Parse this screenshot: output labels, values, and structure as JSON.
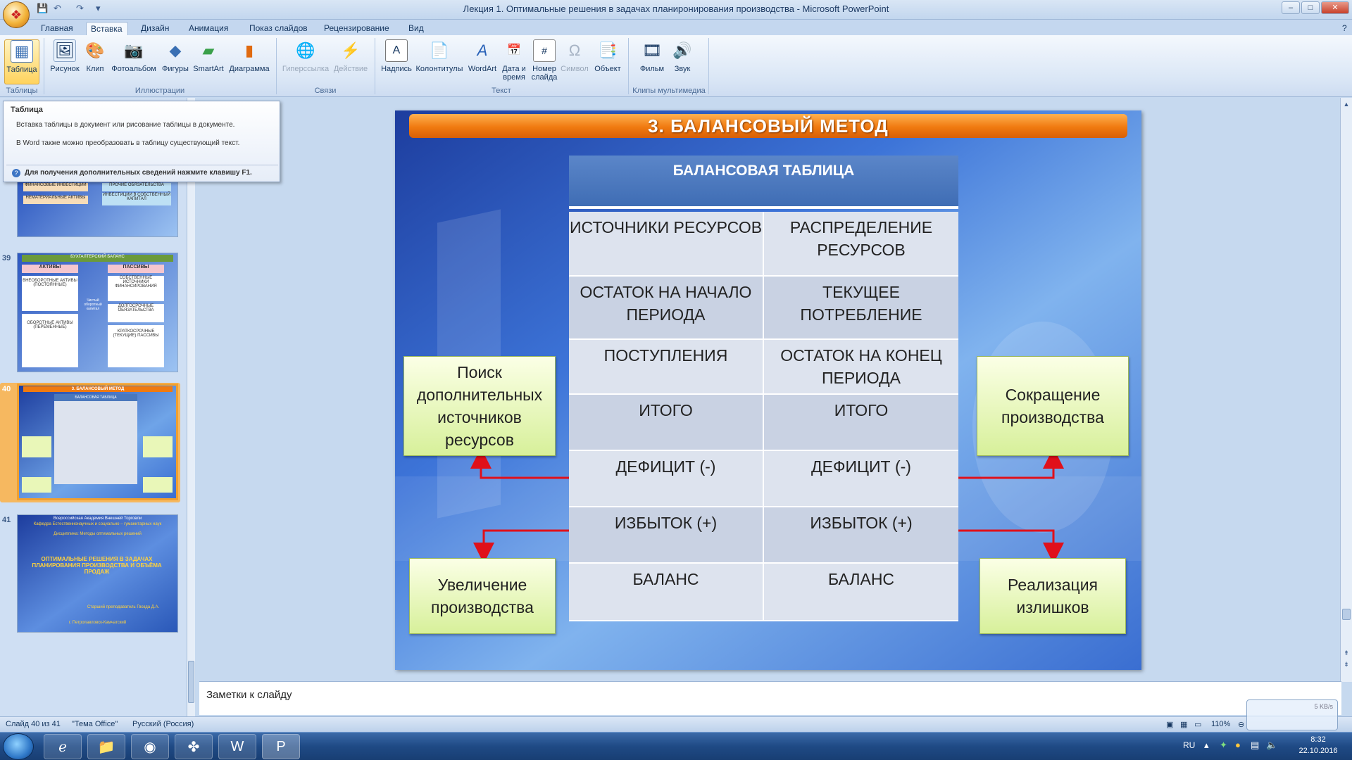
{
  "window": {
    "title": "Лекция 1. Оптимальные решения в задачах планиронирования производства - Microsoft PowerPoint",
    "minimize": "–",
    "maximize": "□",
    "close": "✕"
  },
  "tabs": [
    "Главная",
    "Вставка",
    "Дизайн",
    "Анимация",
    "Показ слайдов",
    "Рецензирование",
    "Вид"
  ],
  "active_tab": "Вставка",
  "ribbon": {
    "buttons": {
      "table": "Таблица",
      "picture": "Рисунок",
      "clip": "Клип",
      "album": "Фотоальбом",
      "shapes": "Фигуры",
      "smartart": "SmartArt",
      "chart": "Диаграмма",
      "hyperlink": "Гиперссылка",
      "action": "Действие",
      "textbox": "Надпись",
      "headers": "Колонтитулы",
      "wordart": "WordArt",
      "datetime": "Дата и время",
      "slidenum": "Номер слайда",
      "symbol": "Символ",
      "object": "Объект",
      "movie": "Фильм",
      "sound": "Звук"
    },
    "groups": {
      "tables": "Таблицы",
      "illustrations": "Иллюстрации",
      "links": "Связи",
      "text": "Текст",
      "media": "Клипы мультимедиа"
    }
  },
  "tooltip": {
    "title": "Таблица",
    "line1": "Вставка таблицы в документ или рисование таблицы в документе.",
    "line2": "В Word также можно преобразовать в таблицу существующий текст.",
    "help": "Для получения дополнительных сведений нажмите клавишу F1."
  },
  "thumbnails": {
    "n39": "39",
    "n40": "40",
    "n41": "41",
    "t38": {
      "a": "ФИНАНСОВЫЕ ИНВЕСТИЦИИ",
      "b": "НЕМАТЕРИАЛЬНЫЕ АКТИВЫ",
      "c": "ПРОЧИЕ ОБЯЗАТЕЛЬСТВА",
      "d": "ИНВЕСТИЦИИ В СОБСТВЕННЫЙ КАПИТАЛ"
    },
    "t39": {
      "head": "БУХГАЛТЕРСКИЙ БАЛАНС",
      "assets": "АКТИВЫ",
      "liab": "ПАССИВЫ",
      "a1": "ВНЕОБОРОТНЫЕ АКТИВЫ (ПОСТОЯННЫЕ)",
      "a2": "ОБОРОТНЫЕ АКТИВЫ (ПЕРЕМЕННЫЕ)",
      "p1": "СОБСТВЕННЫЕ ИСТОЧНИКИ ФИНАНСИРОВАНИЯ",
      "p2": "ДОЛГОСРОЧНЫЕ ОБЯЗАТЕЛЬСТВА",
      "p3": "КРАТКОСРОЧНЫЕ (ТЕКУЩИЕ) ПАССИВЫ",
      "mid": "Чистый оборотный капитал"
    },
    "t40": {
      "head": "3. БАЛАНСОВЫЙ МЕТОД",
      "sub": "БАЛАНСОВАЯ ТАБЛИЦА"
    },
    "t41": {
      "l1": "Всероссийская Академия Внешней Торговли",
      "l2": "Кафедра Естественнонаучных и социально – гуманитарных наук",
      "l3": "Дисциплина: Методы оптимальных решений",
      "l4": "ОПТИМАЛЬНЫЕ РЕШЕНИЯ В ЗАДАЧАХ ПЛАНИРОВАНИЯ ПРОИЗВОДСТВА И ОБЪЁМА ПРОДАЖ",
      "l5": "Старший преподаватель Гвозда Д.А.",
      "l6": "г. Петропавловск-Камчатский"
    }
  },
  "slide": {
    "title": "3. БАЛАНСОВЫЙ МЕТОД",
    "table_header": "БАЛАНСОВАЯ ТАБЛИЦА",
    "rows": [
      [
        "ИСТОЧНИКИ РЕСУРСОВ",
        "РАСПРЕДЕЛЕНИЕ РЕСУРСОВ"
      ],
      [
        "ОСТАТОК НА НАЧАЛО ПЕРИОДА",
        "ТЕКУЩЕЕ ПОТРЕБЛЕНИЕ"
      ],
      [
        "ПОСТУПЛЕНИЯ",
        "ОСТАТОК НА КОНЕЦ ПЕРИОДА"
      ],
      [
        "ИТОГО",
        "ИТОГО"
      ],
      [
        "ДЕФИЦИТ  (-)",
        "ДЕФИЦИТ  (-)"
      ],
      [
        "ИЗБЫТОК (+)",
        "ИЗБЫТОК (+)"
      ],
      [
        "БАЛАНС",
        "БАЛАНС"
      ]
    ],
    "box_search": "Поиск дополнительных источников ресурсов",
    "box_increase": "Увеличение производства",
    "box_reduce": "Сокращение производства",
    "box_sell": "Реализация излишков",
    "colors": {
      "title_bar": "#f07a10",
      "header": "#4a78bd",
      "arrow": "#e0101a",
      "box": "#e9f7b8"
    }
  },
  "notes_placeholder": "Заметки к слайду",
  "status": {
    "slide_of": "Слайд 40 из 41",
    "theme": "\"Тема Office\"",
    "lang": "Русский (Россия)",
    "zoom": "110%"
  },
  "taskbar": {
    "lang": "RU",
    "time": "8:32",
    "date": "22.10.2016",
    "net": "5 KB/s"
  }
}
